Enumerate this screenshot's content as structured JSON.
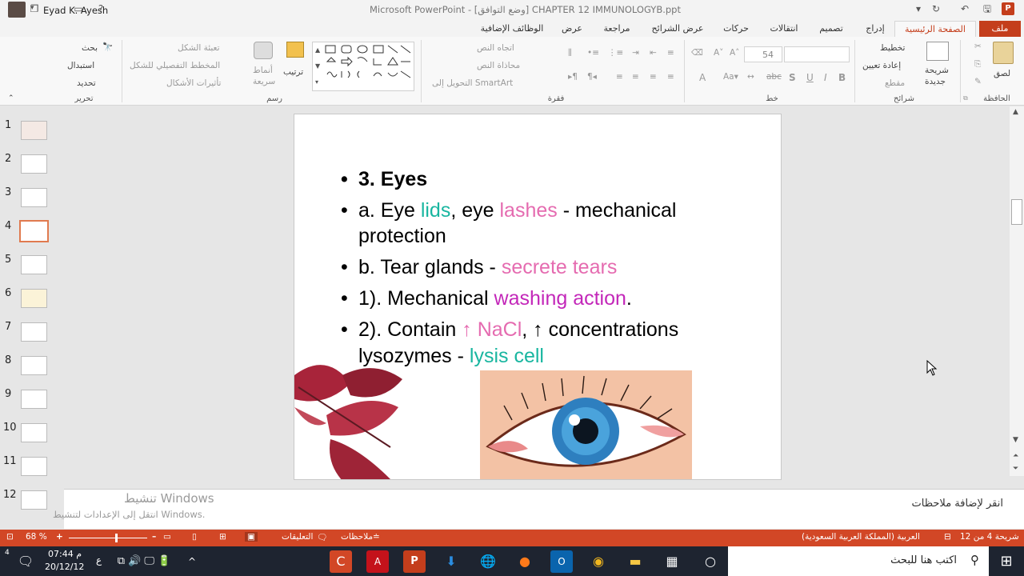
{
  "window": {
    "title": "Microsoft PowerPoint - [وضع التوافق] CHAPTER 12 IMMUNOLOGYB.ppt",
    "user": "Eyad K. Ayesh"
  },
  "tabs": [
    {
      "id": "file",
      "label": "ملف"
    },
    {
      "id": "home",
      "label": "الصفحة الرئيسية"
    },
    {
      "id": "insert",
      "label": "إدراج"
    },
    {
      "id": "design",
      "label": "تصميم"
    },
    {
      "id": "transitions",
      "label": "انتقالات"
    },
    {
      "id": "animations",
      "label": "حركات"
    },
    {
      "id": "slideshow",
      "label": "عرض الشرائح"
    },
    {
      "id": "review",
      "label": "مراجعة"
    },
    {
      "id": "view",
      "label": "عرض"
    },
    {
      "id": "addins",
      "label": "الوظائف الإضافية"
    }
  ],
  "ribbon": {
    "clipboard": {
      "paste": "لصق",
      "label": "الحافظة"
    },
    "slides": {
      "new_slide_1": "شريحة",
      "new_slide_2": "جديدة",
      "layout": "تخطيط",
      "reset": "إعادة تعيين",
      "section": "مقطع",
      "label": "شرائح"
    },
    "font": {
      "size": "54",
      "bold": "B",
      "italic": "I",
      "underline": "U",
      "shadow": "S",
      "strike": "abc",
      "label": "خط"
    },
    "paragraph": {
      "text_direction": "اتجاه النص",
      "align_text": "محاذاة النص",
      "smartart": "التحويل إلى SmartArt",
      "label": "فقرة"
    },
    "drawing": {
      "arrange": "ترتيب",
      "quick_styles_1": "أنماط",
      "quick_styles_2": "سريعة",
      "fill": "تعبئة الشكل",
      "outline": "المخطط التفصيلي للشكل",
      "effects": "تأثيرات الأشكال",
      "label": "رسم"
    },
    "editing": {
      "find": "بحث",
      "replace": "استبدال",
      "select": "تحديد",
      "label": "تحرير"
    }
  },
  "thumbnails": [
    "1",
    "2",
    "3",
    "4",
    "5",
    "6",
    "7",
    "8",
    "9",
    "10",
    "11",
    "12"
  ],
  "selected_slide": 4,
  "slide": {
    "bullet": "•",
    "lines": [
      {
        "t1": "3.  Eyes"
      },
      {
        "t1": "a. Eye ",
        "t2": "lids",
        ",": ",",
        "t3": " eye ",
        "t4": "lashes",
        "t5": " - mechanical"
      },
      {
        "t1": "protection"
      },
      {
        "t1": "b.  Tear glands - ",
        "t2": "secrete tears"
      },
      {
        "t1": "1). Mechanical ",
        "t2": "washing action",
        "t3": "."
      },
      {
        "t1": "2). Contain  ",
        "t2": "↑ NaCl",
        "t3": ",  ↑  concentrations"
      },
      {
        "t1": "lysozymes - ",
        "t2": "lysis cell"
      }
    ]
  },
  "notes": {
    "placeholder": "انقر لإضافة ملاحظات",
    "activate_title": "تنشيط Windows",
    "activate_sub": "انتقل إلى الإعدادات لتنشيط Windows."
  },
  "status": {
    "slide_of": "شريحة 4 من 12",
    "language": "العربية (المملكة العربية السعودية)",
    "notes": "ملاحظات",
    "comments": "التعليقات",
    "zoom": "68 %"
  },
  "taskbar": {
    "search_placeholder": "اكتب هنا للبحث",
    "time": "07:44 م",
    "date": "20/12/12",
    "lang": "ع",
    "notif": "4"
  },
  "colors": {
    "accent": "#d24726",
    "teal": "#19b6a0",
    "pink": "#e56bb0",
    "magenta": "#c327b9"
  }
}
